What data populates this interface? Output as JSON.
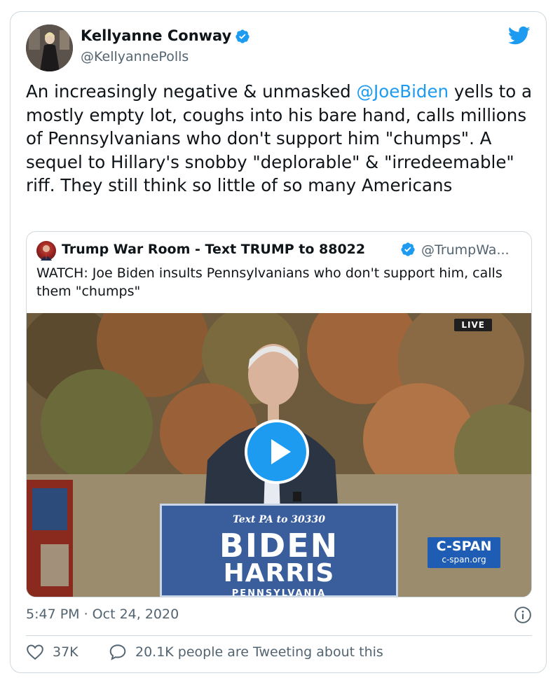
{
  "author": {
    "name": "Kellyanne Conway",
    "handle": "@KellyannePolls",
    "verified": true
  },
  "tweet": {
    "text_before": "An increasingly negative & unmasked ",
    "mention": "@JoeBiden",
    "text_after": " yells to a mostly empty lot, coughs into his bare hand, calls millions of Pennsylvanians who don't support him \"chumps\". A sequel to Hillary's snobby \"deplorable\" & \"irredeemable\"  riff. They still think so little of so many Americans"
  },
  "quoted": {
    "name": "Trump War Room - Text TRUMP to 88022",
    "handle": "@TrumpWa...",
    "verified": true,
    "text": "WATCH: Joe Biden insults Pennsylvanians who don't support him, calls them \"chumps\""
  },
  "media": {
    "live_badge": "LIVE",
    "podium_text": "Text PA to 30330",
    "podium_line1": "BIDEN",
    "podium_line2": "HARRIS",
    "podium_line3": "PENNSYLVANIA",
    "network_logo": "C-SPAN",
    "network_site": "c-span.org",
    "play_icon": "play-icon"
  },
  "meta": {
    "timestamp": "5:47 PM · Oct 24, 2020",
    "info_icon": "info-icon"
  },
  "actions": {
    "likes": "37K",
    "tweeting": "20.1K people are Tweeting about this"
  },
  "colors": {
    "accent": "#1d9bf0",
    "text": "#0f1419",
    "secondary": "#536471",
    "border": "#cfd9de"
  }
}
